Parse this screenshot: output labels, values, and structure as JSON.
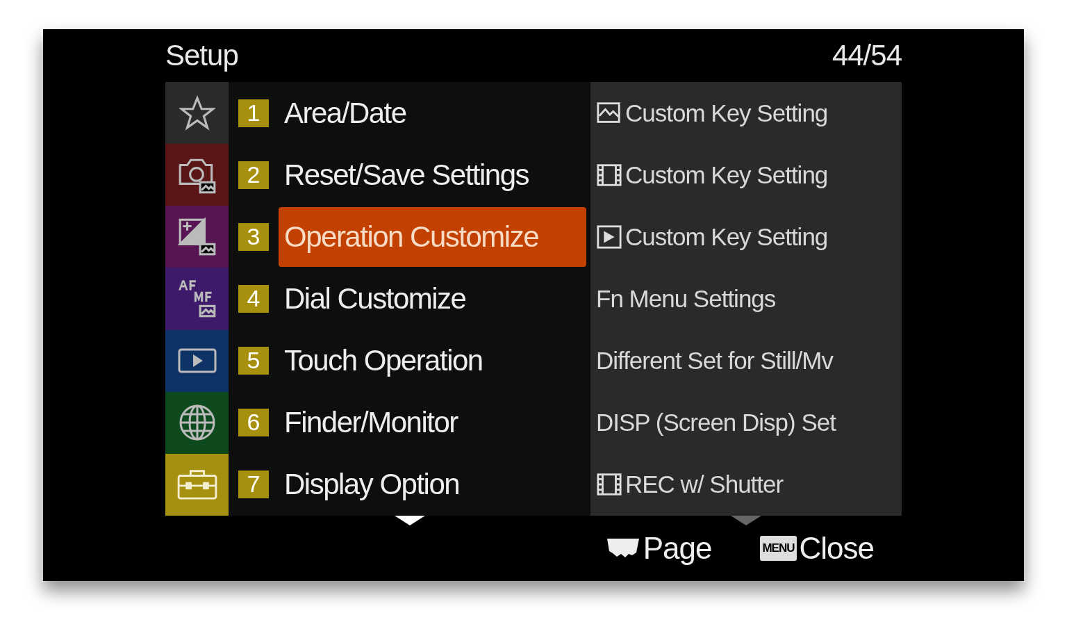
{
  "title": "Setup",
  "page": "44/54",
  "categories": [
    {
      "kind": "star",
      "color": "#2b2b2b",
      "selected": false
    },
    {
      "kind": "camera",
      "color": "#5a1616",
      "selected": false
    },
    {
      "kind": "exposure",
      "color": "#571653",
      "selected": false
    },
    {
      "kind": "afmf",
      "color": "#3e1a6b",
      "selected": false
    },
    {
      "kind": "play",
      "color": "#0e3366",
      "selected": false
    },
    {
      "kind": "globe",
      "color": "#0f4a1f",
      "selected": false
    },
    {
      "kind": "toolbox",
      "color": "#a6900f",
      "selected": true
    }
  ],
  "pages": [
    {
      "number": "1",
      "label": "Area/Date",
      "selected": false
    },
    {
      "number": "2",
      "label": "Reset/Save Settings",
      "selected": false
    },
    {
      "number": "3",
      "label": "Operation Customize",
      "selected": true
    },
    {
      "number": "4",
      "label": "Dial Customize",
      "selected": false
    },
    {
      "number": "5",
      "label": "Touch Operation",
      "selected": false
    },
    {
      "number": "6",
      "label": "Finder/Monitor",
      "selected": false
    },
    {
      "number": "7",
      "label": "Display Option",
      "selected": false
    }
  ],
  "settings": [
    {
      "kind": "still",
      "label": "Custom Key Setting"
    },
    {
      "kind": "movie",
      "label": "Custom Key Setting"
    },
    {
      "kind": "play",
      "label": "Custom Key Setting"
    },
    {
      "kind": "plain",
      "label": "Fn Menu Settings"
    },
    {
      "kind": "plain",
      "label": "Different Set for Still/Mv"
    },
    {
      "kind": "plain",
      "label": "DISP (Screen Disp) Set"
    },
    {
      "kind": "movie",
      "label": "REC w/ Shutter"
    }
  ],
  "footer": {
    "page_label": "Page",
    "menu_key": "MENU",
    "close_label": "Close"
  }
}
